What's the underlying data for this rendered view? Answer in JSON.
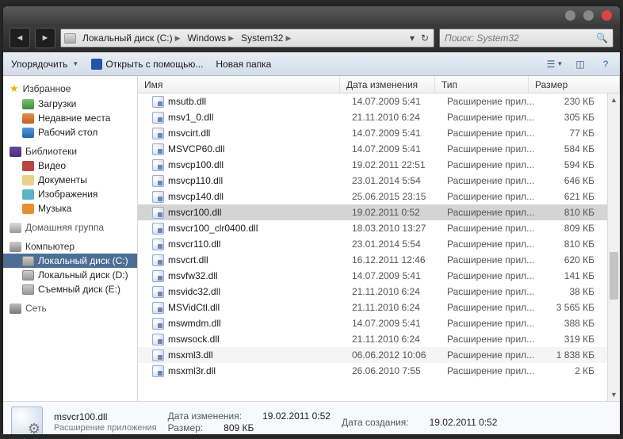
{
  "window": {
    "min": "—",
    "max": "□",
    "close": "×"
  },
  "breadcrumbs": [
    {
      "label": "Локальный диск (C:)",
      "icon": "disk"
    },
    {
      "label": "Windows",
      "icon": "folder"
    },
    {
      "label": "System32",
      "icon": "folder"
    }
  ],
  "search": {
    "placeholder": "Поиск: System32"
  },
  "toolbar": {
    "organize": "Упорядочить",
    "openwith": "Открыть с помощью...",
    "newfolder": "Новая папка"
  },
  "columns": {
    "name": "Имя",
    "date": "Дата изменения",
    "type": "Тип",
    "size": "Размер"
  },
  "sidebar": {
    "fav": "Избранное",
    "fav_items": [
      {
        "label": "Загрузки",
        "ico": "ico-dl"
      },
      {
        "label": "Недавние места",
        "ico": "ico-recent"
      },
      {
        "label": "Рабочий стол",
        "ico": "ico-desk"
      }
    ],
    "lib": "Библиотеки",
    "lib_items": [
      {
        "label": "Видео",
        "ico": "ico-vid"
      },
      {
        "label": "Документы",
        "ico": "ico-doc"
      },
      {
        "label": "Изображения",
        "ico": "ico-img"
      },
      {
        "label": "Музыка",
        "ico": "ico-mus"
      }
    ],
    "homegroup": "Домашняя группа",
    "computer": "Компьютер",
    "drives": [
      {
        "label": "Локальный диск (C:)",
        "sel": true
      },
      {
        "label": "Локальный диск (D:)",
        "sel": false
      },
      {
        "label": "Съемный диск (E:)",
        "sel": false
      }
    ],
    "network": "Сеть"
  },
  "files": [
    {
      "name": "msutb.dll",
      "date": "14.07.2009 5:41",
      "type": "Расширение прил...",
      "size": "230 КБ"
    },
    {
      "name": "msv1_0.dll",
      "date": "21.11.2010 6:24",
      "type": "Расширение прил...",
      "size": "305 КБ"
    },
    {
      "name": "msvcirt.dll",
      "date": "14.07.2009 5:41",
      "type": "Расширение прил...",
      "size": "77 КБ"
    },
    {
      "name": "MSVCP60.dll",
      "date": "14.07.2009 5:41",
      "type": "Расширение прил...",
      "size": "584 КБ"
    },
    {
      "name": "msvcp100.dll",
      "date": "19.02.2011 22:51",
      "type": "Расширение прил...",
      "size": "594 КБ"
    },
    {
      "name": "msvcp110.dll",
      "date": "23.01.2014 5:54",
      "type": "Расширение прил...",
      "size": "646 КБ"
    },
    {
      "name": "msvcp140.dll",
      "date": "25.06.2015 23:15",
      "type": "Расширение прил...",
      "size": "621 КБ"
    },
    {
      "name": "msvcr100.dll",
      "date": "19.02.2011 0:52",
      "type": "Расширение прил...",
      "size": "810 КБ",
      "sel": true
    },
    {
      "name": "msvcr100_clr0400.dll",
      "date": "18.03.2010 13:27",
      "type": "Расширение прил...",
      "size": "809 КБ"
    },
    {
      "name": "msvcr110.dll",
      "date": "23.01.2014 5:54",
      "type": "Расширение прил...",
      "size": "810 КБ"
    },
    {
      "name": "msvcrt.dll",
      "date": "16.12.2011 12:46",
      "type": "Расширение прил...",
      "size": "620 КБ"
    },
    {
      "name": "msvfw32.dll",
      "date": "14.07.2009 5:41",
      "type": "Расширение прил...",
      "size": "141 КБ"
    },
    {
      "name": "msvidc32.dll",
      "date": "21.11.2010 6:24",
      "type": "Расширение прил...",
      "size": "38 КБ"
    },
    {
      "name": "MSVidCtl.dll",
      "date": "21.11.2010 6:24",
      "type": "Расширение прил...",
      "size": "3 565 КБ"
    },
    {
      "name": "mswmdm.dll",
      "date": "14.07.2009 5:41",
      "type": "Расширение прил...",
      "size": "388 КБ"
    },
    {
      "name": "mswsock.dll",
      "date": "21.11.2010 6:24",
      "type": "Расширение прил...",
      "size": "319 КБ"
    },
    {
      "name": "msxml3.dll",
      "date": "06.06.2012 10:06",
      "type": "Расширение прил...",
      "size": "1 838 КБ",
      "alt": true
    },
    {
      "name": "msxml3r.dll",
      "date": "26.06.2010 7:55",
      "type": "Расширение прил...",
      "size": "2 КБ"
    }
  ],
  "details": {
    "name": "msvcr100.dll",
    "type": "Расширение приложения",
    "mod_label": "Дата изменения:",
    "mod": "19.02.2011 0:52",
    "size_label": "Размер:",
    "size": "809 КБ",
    "created_label": "Дата создания:",
    "created": "19.02.2011 0:52"
  }
}
